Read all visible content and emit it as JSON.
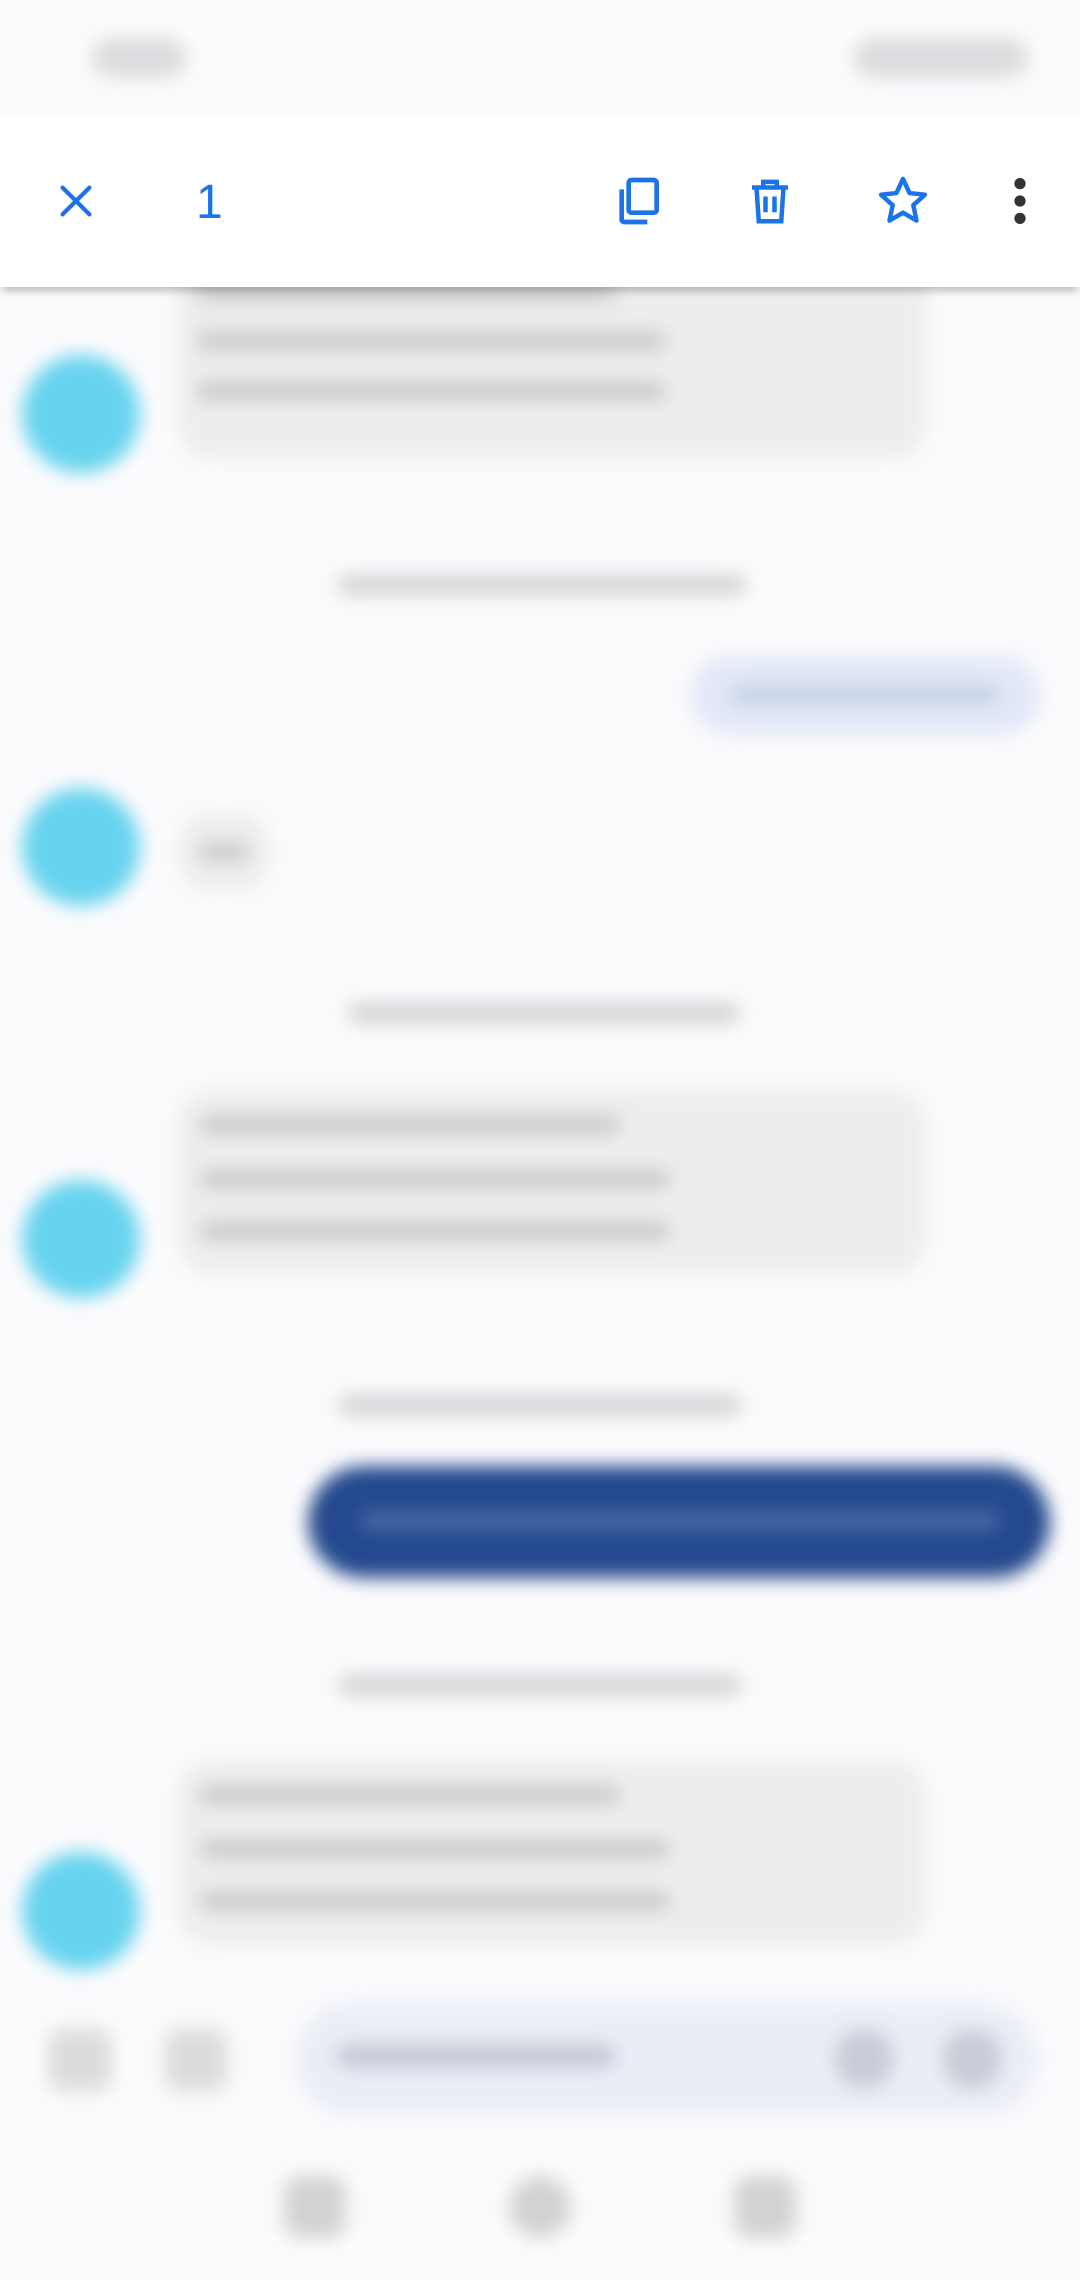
{
  "toolbar": {
    "selected_count": "1",
    "icons": {
      "close": "close-icon",
      "copy": "copy-icon",
      "delete": "delete-icon",
      "star": "star-icon",
      "more": "more-vert-icon"
    },
    "accent_color": "#1a73e8"
  },
  "colors": {
    "avatar": "#67d3ee",
    "incoming_bubble": "#ededee",
    "outgoing_bubble_light": "#e2e8f7",
    "outgoing_bubble_selected": "#24498e"
  }
}
